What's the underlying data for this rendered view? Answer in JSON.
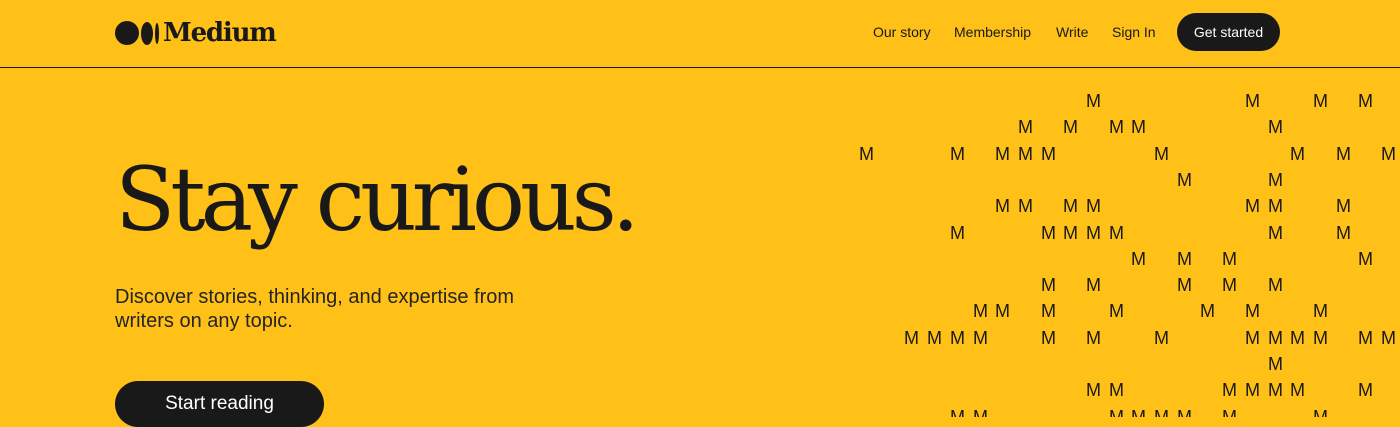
{
  "header": {
    "brand_name": "Medium",
    "nav": {
      "our_story": "Our story",
      "membership": "Membership",
      "write": "Write",
      "sign_in": "Sign In",
      "get_started": "Get started"
    }
  },
  "hero": {
    "title": "Stay curious.",
    "subtitle": "Discover stories, thinking, and expertise from writers on any topic.",
    "cta": "Start reading"
  },
  "decoration": {
    "glyph": "M",
    "rows": [
      "..........M......M..M.M",
      ".......M.M.MM.....M....",
      "M...M.MMM....M.....M.M.MM",
      "..............M...M....",
      "......MM.MM......MM..M.",
      "....M...MMMM......M..M.",
      "............M.M.M.....M.M",
      "........M.M...M.M.M....",
      ".....MM.M..M...M.M..M..",
      "..MMMM..M.M..M...MMMM.MMM",
      "..................M....",
      "..........MM....MMMM..M",
      "....MM.....MMMM.M...M.."
    ]
  },
  "colors": {
    "background": "#FFC017",
    "text": "#191919",
    "button_bg": "#191919",
    "button_text": "#FFFFFF"
  }
}
